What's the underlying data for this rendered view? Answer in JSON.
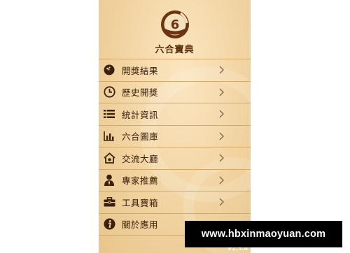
{
  "app": {
    "title": "六合寶典",
    "logo_text": "6",
    "logo_icon": "ball-6-logo",
    "version": "V2.5.4"
  },
  "menu": {
    "items": [
      {
        "label": "開獎結果",
        "icon": "ball-icon"
      },
      {
        "label": "歷史開獎",
        "icon": "clock-icon"
      },
      {
        "label": "統計資訊",
        "icon": "list-icon"
      },
      {
        "label": "六合圖庫",
        "icon": "bar-chart-icon"
      },
      {
        "label": "交流大廳",
        "icon": "home-chat-icon"
      },
      {
        "label": "專家推薦",
        "icon": "user-tie-icon"
      },
      {
        "label": "工具寶箱",
        "icon": "toolbox-icon"
      },
      {
        "label": "關於應用",
        "icon": "info-icon"
      }
    ]
  },
  "watermark": {
    "text": "www.hbxinmaoyuan.com"
  },
  "colors": {
    "icon": "#3b200b",
    "divider": "#d6a867",
    "title": "#5a2f0c",
    "chevron": "#8c7053"
  }
}
